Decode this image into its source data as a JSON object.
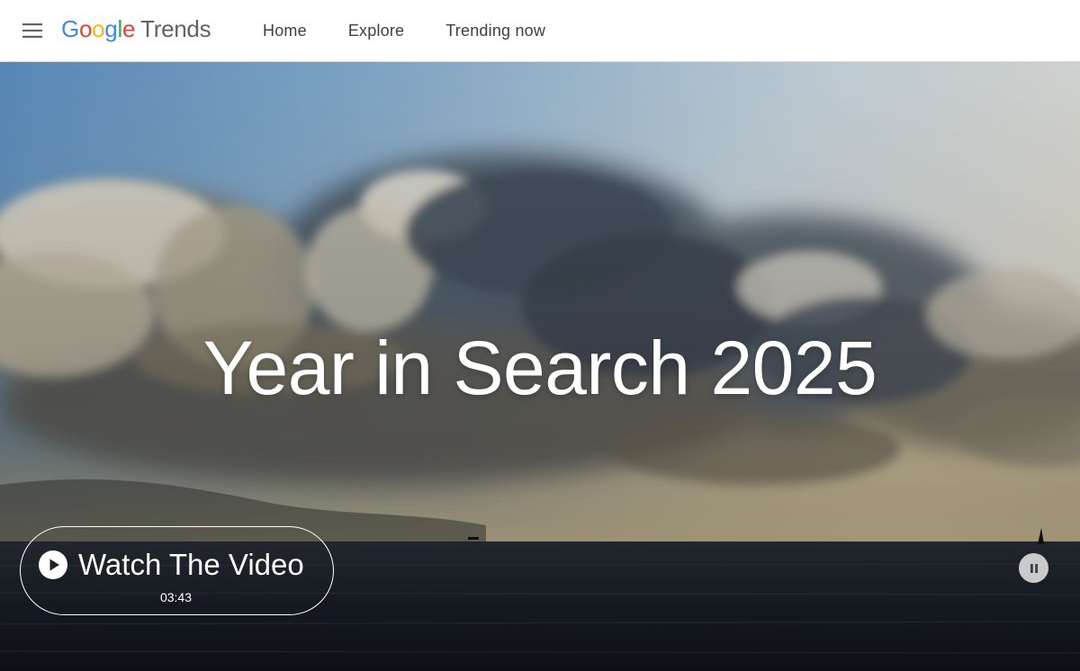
{
  "header": {
    "menu_icon": "hamburger-menu-icon",
    "logo": {
      "google_letters": [
        {
          "char": "G",
          "color": "#4285F4"
        },
        {
          "char": "o",
          "color": "#EA4335"
        },
        {
          "char": "o",
          "color": "#FBBC05"
        },
        {
          "char": "g",
          "color": "#4285F4"
        },
        {
          "char": "l",
          "color": "#34A853"
        },
        {
          "char": "e",
          "color": "#EA4335"
        }
      ],
      "product": "Trends"
    },
    "nav": [
      {
        "label": "Home"
      },
      {
        "label": "Explore"
      },
      {
        "label": "Trending now"
      }
    ]
  },
  "hero": {
    "title": "Year in Search 2025",
    "video": {
      "label": "Watch The Video",
      "duration": "03:43",
      "play_icon": "play-circle-icon",
      "pause_icon": "pause-icon"
    }
  },
  "colors": {
    "header_bg": "#ffffff",
    "nav_text": "#3c4043",
    "trends_text": "#5f6368",
    "hero_text": "#ffffff"
  }
}
